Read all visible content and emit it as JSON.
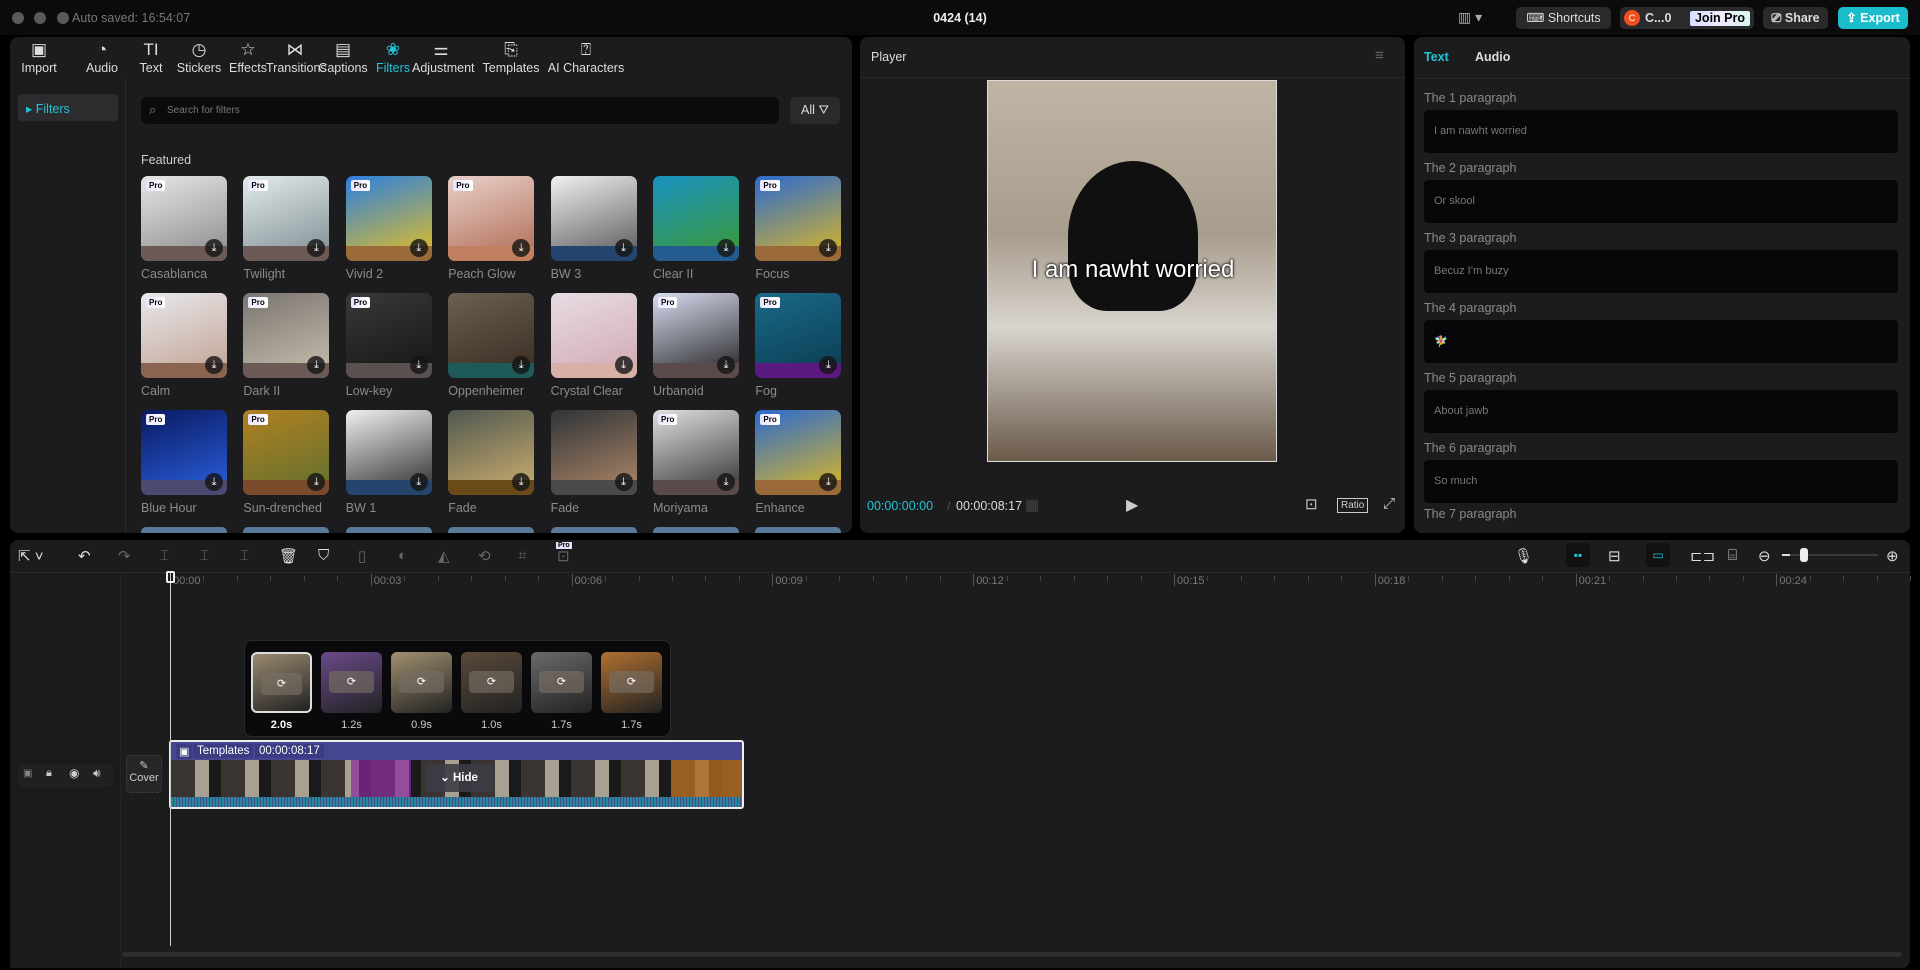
{
  "titlebar": {
    "autosave": "Auto saved: 16:54:07",
    "project_title": "0424 (14)",
    "shortcuts": "Shortcuts",
    "user": "C...0",
    "user_initial": "C",
    "join_pro": "Join Pro",
    "share": "Share",
    "export": "Export"
  },
  "toolbar": [
    {
      "label": "Import",
      "icon": "import-icon",
      "glyph": "▣"
    },
    {
      "label": "Audio",
      "icon": "audio-icon",
      "glyph": "◔"
    },
    {
      "label": "Text",
      "icon": "text-icon",
      "glyph": "TI"
    },
    {
      "label": "Stickers",
      "icon": "sticker-icon",
      "glyph": "◷"
    },
    {
      "label": "Effects",
      "icon": "effects-icon",
      "glyph": "☆"
    },
    {
      "label": "Transitions",
      "icon": "transitions-icon",
      "glyph": "⋈"
    },
    {
      "label": "Captions",
      "icon": "captions-icon",
      "glyph": "▤"
    },
    {
      "label": "Filters",
      "icon": "filters-icon",
      "glyph": "❀",
      "active": true
    },
    {
      "label": "Adjustment",
      "icon": "adjustment-icon",
      "glyph": "⚌"
    },
    {
      "label": "Templates",
      "icon": "templates-icon",
      "glyph": "⎘"
    },
    {
      "label": "AI Characters",
      "icon": "ai-characters-icon",
      "glyph": "⍰"
    }
  ],
  "sidebar": {
    "item": "Filters"
  },
  "search": {
    "placeholder": "Search for filters",
    "filter_label": "All"
  },
  "section_title": "Featured",
  "filters": [
    {
      "name": "Casablanca",
      "pro": true,
      "c1": "#e6e6e6",
      "c2": "#8a8a8a",
      "band": "#6b5a55"
    },
    {
      "name": "Twilight",
      "pro": true,
      "c1": "#e2eaec",
      "c2": "#7e8c90",
      "band": "#6b5a55"
    },
    {
      "name": "Vivid 2",
      "pro": true,
      "c1": "#2b7fe0",
      "c2": "#e8c020",
      "band": "#9a6a3a"
    },
    {
      "name": "Peach Glow",
      "pro": true,
      "c1": "#e8d0c8",
      "c2": "#b06a55",
      "band": "#c08060"
    },
    {
      "name": "BW 3",
      "pro": false,
      "c1": "#f0f0f0",
      "c2": "#555555",
      "band": "#24466e"
    },
    {
      "name": "Clear II",
      "pro": false,
      "c1": "#1890c0",
      "c2": "#3c9a30",
      "band": "#245c90"
    },
    {
      "name": "Focus",
      "pro": true,
      "c1": "#2a6ad0",
      "c2": "#e0b820",
      "band": "#9a6a3a"
    },
    {
      "name": "Calm",
      "pro": true,
      "c1": "#e8e8ec",
      "c2": "#c0a090",
      "band": "#8a6450"
    },
    {
      "name": "Dark II",
      "pro": true,
      "c1": "#7a7570",
      "c2": "#c8c0b0",
      "band": "#6b5a55"
    },
    {
      "name": "Low-key",
      "pro": true,
      "c1": "#3a3838",
      "c2": "#151515",
      "band": "#5a5050"
    },
    {
      "name": "Oppenheimer",
      "pro": false,
      "c1": "#6a6050",
      "c2": "#3a2a20",
      "band": "#1f5a5a"
    },
    {
      "name": "Crystal Clear",
      "pro": false,
      "c1": "#e8dce4",
      "c2": "#d0a8b0",
      "band": "#d8b0a8"
    },
    {
      "name": "Urbanoid",
      "pro": true,
      "c1": "#d8dcf0",
      "c2": "#202020",
      "band": "#5a4a4a"
    },
    {
      "name": "Fog",
      "pro": true,
      "c1": "#1a6a88",
      "c2": "#0a3a50",
      "band": "#5a1a80"
    },
    {
      "name": "Blue Hour",
      "pro": true,
      "c1": "#0a1a60",
      "c2": "#2a60e0",
      "band": "#4a4a70"
    },
    {
      "name": "Sun-drenched",
      "pro": true,
      "c1": "#b08020",
      "c2": "#607030",
      "band": "#7a4a2a"
    },
    {
      "name": "BW 1",
      "pro": false,
      "c1": "#f0f0f0",
      "c2": "#2a2a2a",
      "band": "#24466e"
    },
    {
      "name": "Fade",
      "pro": false,
      "c1": "#505850",
      "c2": "#d0b070",
      "band": "#6a4a18"
    },
    {
      "name": "Fade",
      "pro": false,
      "c1": "#303438",
      "c2": "#b08868",
      "band": "#4a4a4a"
    },
    {
      "name": "Moriyama",
      "pro": true,
      "c1": "#e0e0e0",
      "c2": "#303030",
      "band": "#5a4a4a"
    },
    {
      "name": "Enhance",
      "pro": true,
      "c1": "#2a6ad0",
      "c2": "#e0b820",
      "band": "#9a6a3a"
    }
  ],
  "player": {
    "title": "Player",
    "caption": "I am nawht worried",
    "current_time": "00:00:00:00",
    "total_time": "00:00:08:17",
    "ratio": "Ratio"
  },
  "right_panel": {
    "tabs": [
      {
        "label": "Text",
        "active": true
      },
      {
        "label": "Audio",
        "active": false
      }
    ],
    "paragraphs": [
      {
        "label": "The 1 paragraph",
        "value": "I am nawht worried"
      },
      {
        "label": "The 2 paragraph",
        "value": "Or skool"
      },
      {
        "label": "The 3 paragraph",
        "value": "Becuz I’m buzy"
      },
      {
        "label": "The 4 paragraph",
        "value": "🧚‍♀️"
      },
      {
        "label": "The 5 paragraph",
        "value": "About jawb"
      },
      {
        "label": "The 6 paragraph",
        "value": "So much"
      }
    ],
    "next_label": "The 7 paragraph"
  },
  "timeline": {
    "pro_badge": "Pro",
    "ruler": [
      "00:00",
      "00:03",
      "00:06",
      "00:09",
      "00:12",
      "00:15",
      "00:18",
      "00:21",
      "00:24"
    ],
    "clips": [
      {
        "duration": "2.0s",
        "color": "#9a8a70"
      },
      {
        "duration": "1.2s",
        "color": "#6a4a8a"
      },
      {
        "duration": "0.9s",
        "color": "#a09070"
      },
      {
        "duration": "1.0s",
        "color": "#5a4a3a"
      },
      {
        "duration": "1.7s",
        "color": "#6a6a6a"
      },
      {
        "duration": "1.7s",
        "color": "#b07030"
      }
    ],
    "track": {
      "label": "Templates",
      "duration": "00:00:08:17",
      "hide": "Hide",
      "cover": "Cover"
    },
    "zoom_level": 0.08
  },
  "colors": {
    "accent": "#22c3d6",
    "track": "#45468f"
  }
}
